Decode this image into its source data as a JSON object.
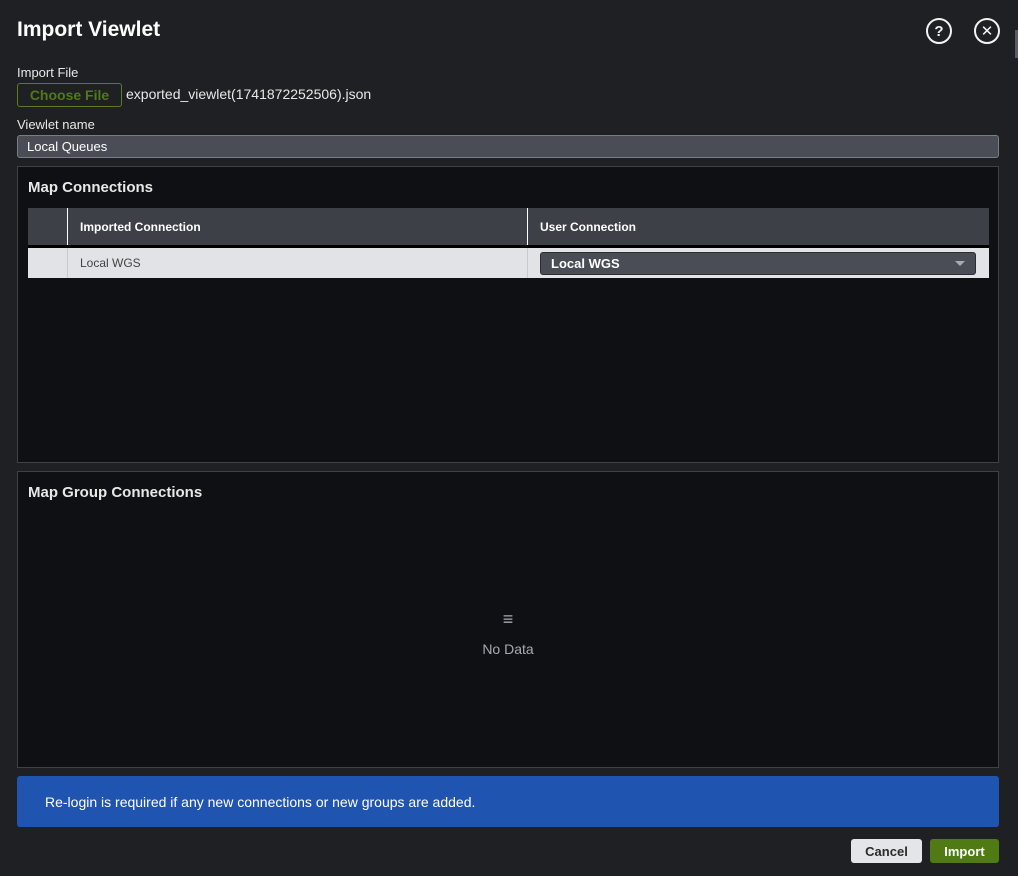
{
  "dialog": {
    "title": "Import Viewlet",
    "help_icon": "question-circle-icon",
    "close_icon": "close-circle-icon"
  },
  "import_file": {
    "label": "Import File",
    "button_label": "Choose File",
    "file_name": "exported_viewlet(1741872252506).json"
  },
  "viewlet_name": {
    "label": "Viewlet name",
    "value": "Local Queues"
  },
  "map_connections": {
    "title": "Map Connections",
    "columns": [
      "",
      "Imported Connection",
      "User Connection"
    ],
    "rows": [
      {
        "imported": "Local WGS",
        "user": "Local WGS"
      }
    ]
  },
  "map_group_connections": {
    "title": "Map Group Connections",
    "empty_icon": "list-icon",
    "empty_icon_glyph": "≡",
    "empty_text": "No Data"
  },
  "banner": {
    "text": "Re-login is required if any new connections or new groups are added."
  },
  "footer": {
    "cancel_label": "Cancel",
    "import_label": "Import"
  },
  "colors": {
    "accent_green": "#4f7a14",
    "banner_blue": "#1f55b0",
    "background": "#1f2024"
  }
}
